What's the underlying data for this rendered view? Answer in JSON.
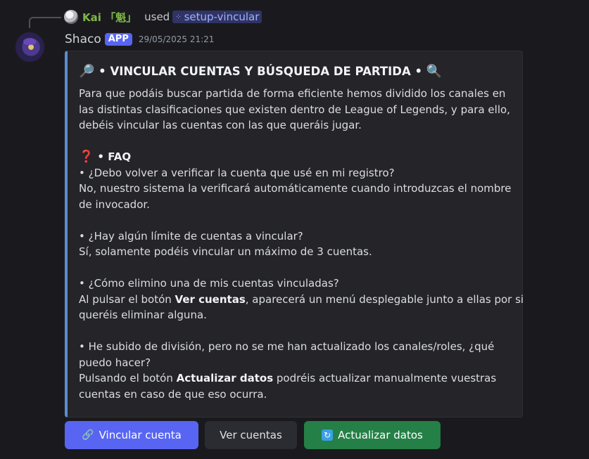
{
  "reply": {
    "username": "Kai 「魁」",
    "used_text": "used",
    "command": "setup-vincular",
    "command_icon": "apps-icon"
  },
  "message": {
    "author": "Shaco",
    "badge": "APP",
    "timestamp": "29/05/2025 21:21"
  },
  "embed": {
    "accent_color": "#5a8ed1",
    "title_emoji": "🔎",
    "title_emoji_end": "🔍",
    "title": " • VINCULAR CUENTAS Y BÚSQUEDA DE PARTIDA • ",
    "intro": [
      "Para que podáis buscar partida de forma eficiente hemos dividido los canales en",
      "las distintas clasificaciones que existen dentro de League of Legends, y para ello,",
      "debéis vincular las cuentas con las que queráis jugar."
    ],
    "faq_emoji": "❓",
    "faq_heading": " • FAQ",
    "faq": {
      "q1": "• ¿Debo volver a verificar la cuenta que usé en mi registro?",
      "a1_line1": "No, nuestro sistema la verificará automáticamente cuando introduzcas el nombre",
      "a1_line2": "de invocador.",
      "q2": "• ¿Hay algún límite de cuentas a vincular?",
      "a2": "Sí, solamente podéis vincular un máximo de 3 cuentas.",
      "q3": "• ¿Cómo elimino una de mis cuentas vinculadas?",
      "a3_pre": "Al pulsar el botón ",
      "a3_bold": "Ver cuentas",
      "a3_post": ", aparecerá un menú desplegable junto a ellas por si",
      "a3_line2": "queréis eliminar alguna.",
      "q4_line1": "• He subido de división, pero no se me han actualizado los canales/roles, ¿qué",
      "q4_line2": "puedo hacer?",
      "a4_pre": "Pulsando el botón ",
      "a4_bold": "Actualizar datos",
      "a4_post": " podréis actualizar manualmente vuestras",
      "a4_line2": "cuentas en caso de que eso ocurra."
    }
  },
  "buttons": {
    "link": {
      "icon": "🔗",
      "label": "Vincular cuenta",
      "color": "#5865f2"
    },
    "ver": {
      "label": "Ver cuentas",
      "color": "#2b2c31"
    },
    "update": {
      "icon": "🔄",
      "label": "Actualizar datos",
      "color": "#248046"
    }
  }
}
